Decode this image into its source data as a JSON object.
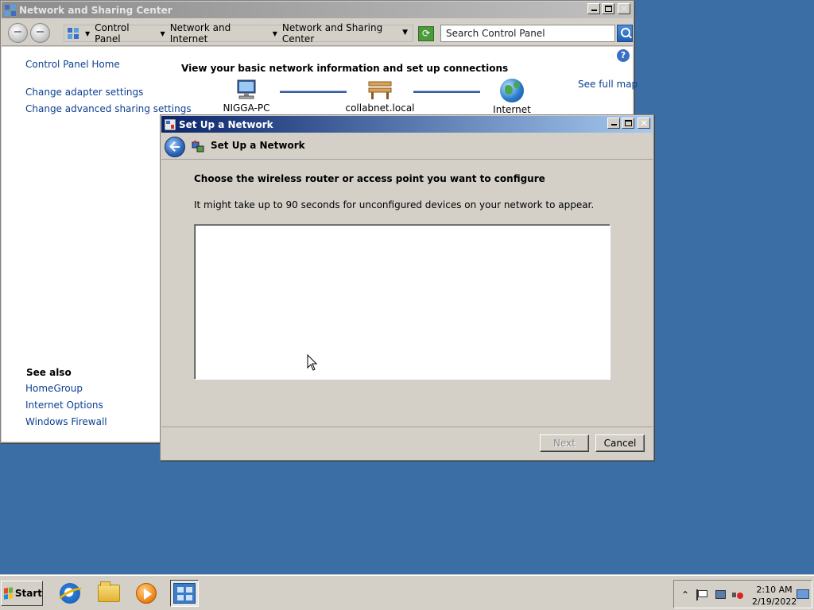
{
  "network_center": {
    "title": "Network and Sharing Center",
    "breadcrumbs": [
      "Control Panel",
      "Network and Internet",
      "Network and Sharing Center"
    ],
    "search_placeholder": "Search Control Panel",
    "sidebar": {
      "home": "Control Panel Home",
      "links": [
        "Change adapter settings",
        "Change advanced sharing settings"
      ],
      "see_also_title": "See also",
      "see_also": [
        "HomeGroup",
        "Internet Options",
        "Windows Firewall"
      ]
    },
    "heading": "View your basic network information and set up connections",
    "see_full_map": "See full map",
    "map_nodes": [
      "NIGGA-PC",
      "collabnet.local",
      "Internet"
    ]
  },
  "setup_dialog": {
    "title": "Set Up a Network",
    "header_title": "Set Up a Network",
    "instruction": "Choose the wireless router or access point you want to configure",
    "note": "It might take up to 90 seconds for unconfigured devices on your network to appear.",
    "devices": [],
    "buttons": {
      "next": "Next",
      "cancel": "Cancel"
    }
  },
  "taskbar": {
    "start_label": "Start",
    "pinned": [
      "internet-explorer",
      "windows-explorer",
      "windows-media-player",
      "network-and-sharing-center"
    ],
    "clock": {
      "time": "2:10 AM",
      "date": "2/19/2022"
    }
  }
}
